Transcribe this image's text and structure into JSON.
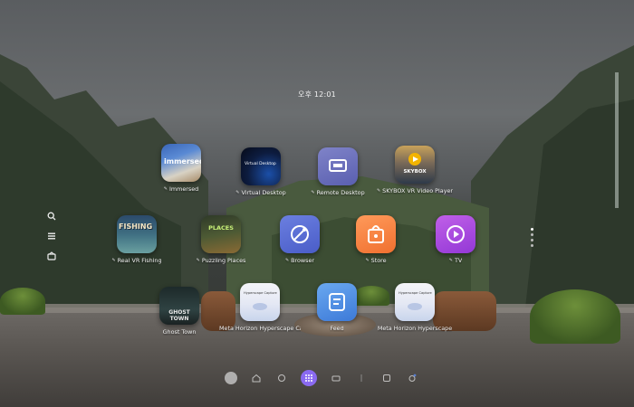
{
  "clock": {
    "time": "오후 12:01"
  },
  "left_rail": [
    {
      "icon": "search-icon"
    },
    {
      "icon": "list-icon"
    },
    {
      "icon": "library-icon"
    }
  ],
  "apps": [
    {
      "label": "Immersed",
      "tile_text": "immersed",
      "icon": "immersed-icon"
    },
    {
      "label": "Virtual Desktop",
      "tile_text": "Virtual Desktop",
      "icon": "virtual-desktop-icon"
    },
    {
      "label": "Remote Desktop",
      "tile_text": "",
      "icon": "remote-desktop-icon"
    },
    {
      "label": "SKYBOX VR Video Player",
      "tile_text": "SKYBOX",
      "icon": "skybox-icon"
    },
    {
      "label": "Real VR Fishing",
      "tile_text": "FISHING",
      "icon": "fishing-icon"
    },
    {
      "label": "Puzzling Places",
      "tile_text": "PLACES",
      "icon": "puzzling-places-icon"
    },
    {
      "label": "Browser",
      "tile_text": "",
      "icon": "browser-icon"
    },
    {
      "label": "Store",
      "tile_text": "",
      "icon": "store-icon"
    },
    {
      "label": "TV",
      "tile_text": "",
      "icon": "tv-icon"
    },
    {
      "label": "Ghost Town",
      "tile_text": "GHOST TOWN",
      "icon": "ghost-town-icon"
    },
    {
      "label": "Meta Horizon Hyperscape Capture",
      "tile_text": "Hyperscape Capture",
      "icon": "hyperscape-capture-icon"
    },
    {
      "label": "Feed",
      "tile_text": "",
      "icon": "feed-icon"
    },
    {
      "label": "Meta Horizon Hyperscape",
      "tile_text": "Hyperscape Capture",
      "icon": "hyperscape-icon"
    }
  ],
  "dock": [
    {
      "icon": "avatar-icon"
    },
    {
      "icon": "home-icon"
    },
    {
      "icon": "people-icon"
    },
    {
      "icon": "apps-grid-icon",
      "active": true
    },
    {
      "icon": "camera-icon"
    },
    {
      "icon": "divider-icon"
    },
    {
      "icon": "settings-icon"
    },
    {
      "icon": "notifications-icon"
    }
  ],
  "colors": {
    "active_dock": "#8a6af0",
    "browser_tile": "#5a6ed4",
    "store_tile": "#f4823f",
    "tv_tile": "#a848de",
    "feed_tile": "#4a88e0"
  }
}
